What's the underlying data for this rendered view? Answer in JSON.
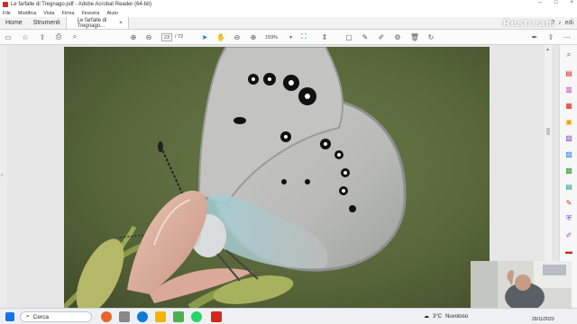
{
  "window": {
    "title": "Le farfalle di Tregnago.pdf - Adobe Acrobat Reader (64-bit)",
    "controls": {
      "minimize": "–",
      "maximize": "□",
      "close": "×"
    }
  },
  "menu": [
    "File",
    "Modifica",
    "Vista",
    "Firma",
    "Finestra",
    "Aiuto"
  ],
  "tabs": {
    "home": "Home",
    "tools": "Strumenti",
    "document": "Le farfalle di Tregnago...",
    "document_close": "×"
  },
  "watermark": "Restream",
  "right_header": "edi",
  "toolbar": {
    "current_page": "23",
    "total_pages": "/ 72",
    "zoom": "159%",
    "zoom_caret": "▾"
  },
  "taskbar": {
    "search_placeholder": "Cerca",
    "weather": "3°C",
    "weather_desc": "Nuvoloso",
    "date": "29/11/2023"
  },
  "colors": {
    "accent": "#1473e6",
    "acrobat_red": "#d4281e",
    "photo_background": "#5c6b3c"
  },
  "icons": {
    "bookmark": "save-icon",
    "star": "star-icon",
    "upload": "upload-icon",
    "print": "print-icon",
    "search": "search-icon",
    "prev": "page-up-icon",
    "next": "page-down-icon",
    "select": "cursor-icon",
    "hand": "hand-icon",
    "zoom_out": "zoom-out-icon",
    "zoom_in": "zoom-in-icon"
  }
}
